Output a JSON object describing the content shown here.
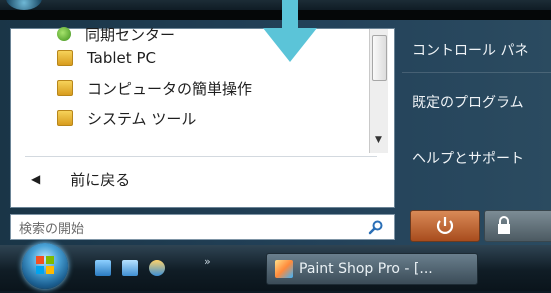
{
  "start_menu": {
    "programs": [
      {
        "label": "同期センター",
        "icon": "sync-center-icon"
      },
      {
        "label": "Tablet PC",
        "icon": "folder-icon"
      },
      {
        "label": "コンピュータの簡単操作",
        "icon": "folder-icon"
      },
      {
        "label": "システム ツール",
        "icon": "folder-icon"
      }
    ],
    "back_label": "前に戻る",
    "search_placeholder": "検索の開始",
    "right_items": [
      "コントロール パネ",
      "既定のプログラム",
      "ヘルプとサポート"
    ]
  },
  "taskbar": {
    "task_button_label": "Paint Shop Pro - [..."
  },
  "colors": {
    "arrow": "#5bc4d8",
    "power_button": "#c46a36"
  }
}
